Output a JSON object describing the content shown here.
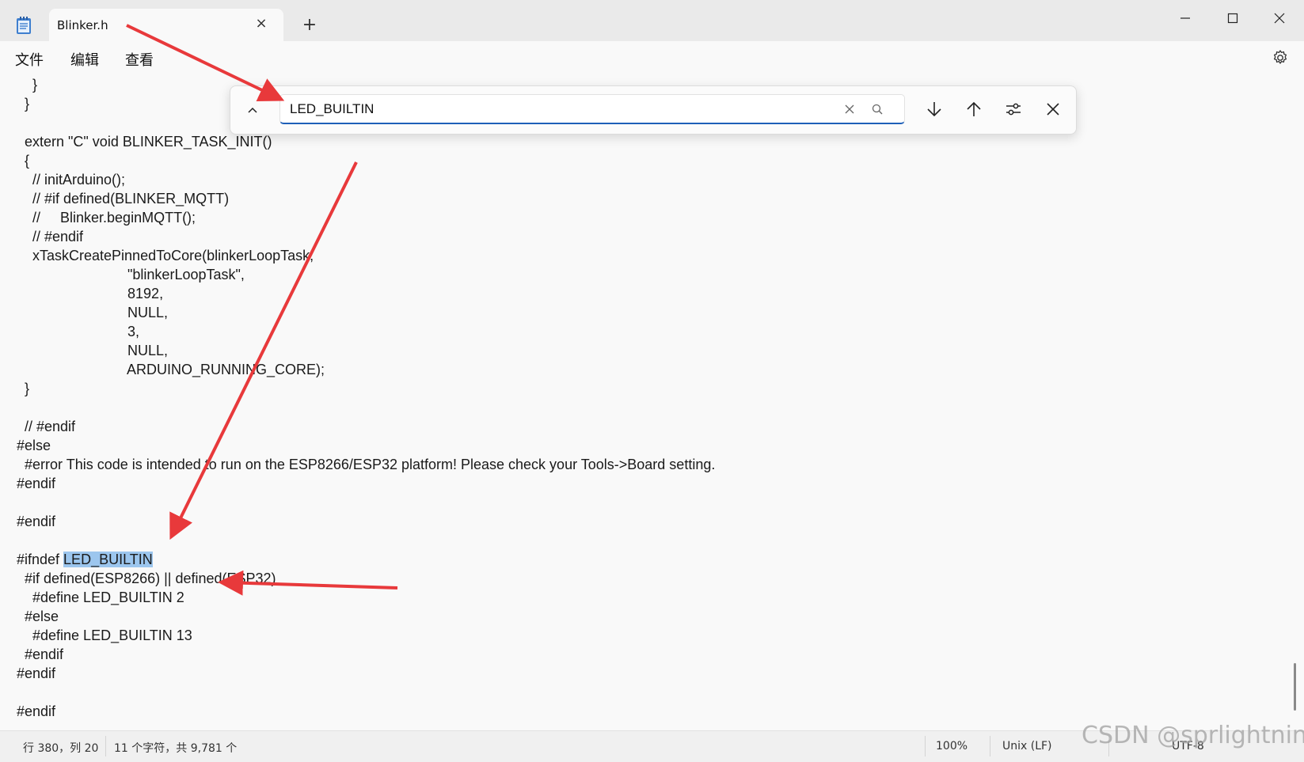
{
  "window": {
    "tab_title": "Blinker.h",
    "new_tab_symbol": "+",
    "tab_close_symbol": "×",
    "minimize_icon": "minimize-icon",
    "maximize_icon": "maximize-icon",
    "close_icon": "close-icon"
  },
  "menu": {
    "items": [
      "文件",
      "编辑",
      "查看"
    ],
    "settings_icon": "gear-icon"
  },
  "find": {
    "value": "LED_BUILTIN",
    "accent_color": "#1d5fb8"
  },
  "code": {
    "lines": [
      "    }",
      "  }",
      "",
      "  extern \"C\" void BLINKER_TASK_INIT()",
      "  {",
      "    // initArduino();",
      "    // #if defined(BLINKER_MQTT)",
      "    //     Blinker.beginMQTT();",
      "    // #endif",
      "    xTaskCreatePinnedToCore(blinkerLoopTask,",
      "                            \"blinkerLoopTask\",",
      "                            8192,",
      "                            NULL,",
      "                            3,",
      "                            NULL,",
      "                            ARDUINO_RUNNING_CORE);",
      "  }",
      "",
      "  // #endif",
      "#else",
      "  #error This code is intended to run on the ESP8266/ESP32 platform! Please check your Tools->Board setting.",
      "#endif",
      "",
      "#endif",
      "",
      "#ifndef LED_BUILTIN",
      "  #if defined(ESP8266) || defined(ESP32)",
      "    #define LED_BUILTIN 2",
      "  #else",
      "    #define LED_BUILTIN 13",
      "  #endif",
      "#endif",
      "",
      "#endif"
    ],
    "highlight": {
      "line": 25,
      "before": "#ifndef ",
      "match": "LED_BUILTIN",
      "color": "#9cc6ee"
    }
  },
  "status": {
    "position": "行 380，列 20",
    "chars": "11 个字符，共 9,781 个",
    "zoom": "100%",
    "line_ending": "Unix (LF)",
    "encoding": "UTF-8"
  },
  "watermark": "CSDN @sprlightning",
  "annotation_color": "#e8393b"
}
